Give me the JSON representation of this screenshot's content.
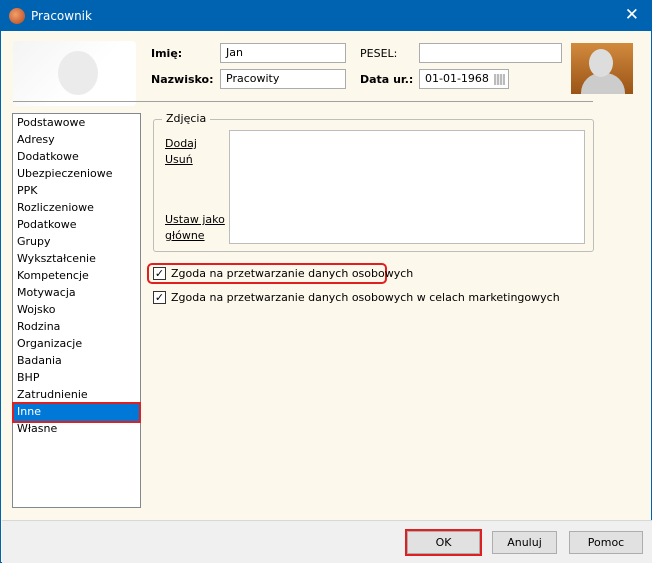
{
  "window": {
    "title": "Pracownik",
    "close": "✕"
  },
  "header": {
    "first_name_label": "Imię:",
    "first_name": "Jan",
    "last_name_label": "Nazwisko:",
    "last_name": "Pracowity",
    "pesel_label": "PESEL:",
    "pesel": "",
    "birth_label": "Data ur.:",
    "birth": "01-01-1968"
  },
  "sidebar": {
    "items": [
      "Podstawowe",
      "Adresy",
      "Dodatkowe",
      "Ubezpieczeniowe",
      "PPK",
      "Rozliczeniowe",
      "Podatkowe",
      "Grupy",
      "Wykształcenie",
      "Kompetencje",
      "Motywacja",
      "Wojsko",
      "Rodzina",
      "Organizacje",
      "Badania",
      "BHP",
      "Zatrudnienie",
      "Inne",
      "Własne"
    ],
    "selected": "Inne"
  },
  "photos": {
    "legend": "Zdjęcia",
    "add": "Dodaj",
    "remove": "Usuń",
    "set_main_1": "Ustaw jako",
    "set_main_2": "główne"
  },
  "consents": [
    {
      "label": "Zgoda na przetwarzanie danych osobowych",
      "checked": true
    },
    {
      "label": "Zgoda na przetwarzanie danych osobowych w celach marketingowych",
      "checked": true
    }
  ],
  "footer": {
    "ok": "OK",
    "cancel": "Anuluj",
    "help": "Pomoc"
  }
}
